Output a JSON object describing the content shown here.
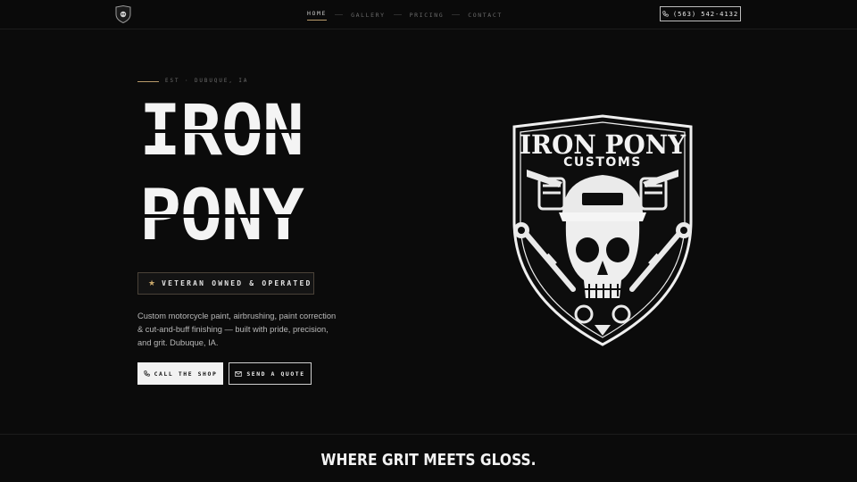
{
  "nav": {
    "links": [
      {
        "label": "HOME",
        "active": true
      },
      {
        "label": "GALLERY",
        "active": false
      },
      {
        "label": "PRICING",
        "active": false
      },
      {
        "label": "CONTACT",
        "active": false
      }
    ],
    "phone_label": "(563) 542-4132",
    "logo_icon": "shield-skull-icon"
  },
  "hero": {
    "eyebrow": "EST · DUBUQUE, IA",
    "title_line1": "IRON",
    "title_line2": "PONY",
    "badge": "VETERAN OWNED & OPERATED",
    "description": "Custom motorcycle paint, airbrushing, paint correction & cut-and-buff finishing — built with pride, precision, and grit. Dubuque, IA.",
    "call_button": "CALL THE SHOP",
    "quote_button": "SEND A QUOTE"
  },
  "emblem": {
    "line1": "IRON PONY",
    "line2": "CUSTOMS",
    "icon": "skull-pistons-emblem"
  },
  "section": {
    "title": "WHERE GRIT MEETS GLOSS."
  },
  "colors": {
    "background": "#0b0b0b",
    "accent": "#b89a6a",
    "text": "#f4f4f4"
  }
}
